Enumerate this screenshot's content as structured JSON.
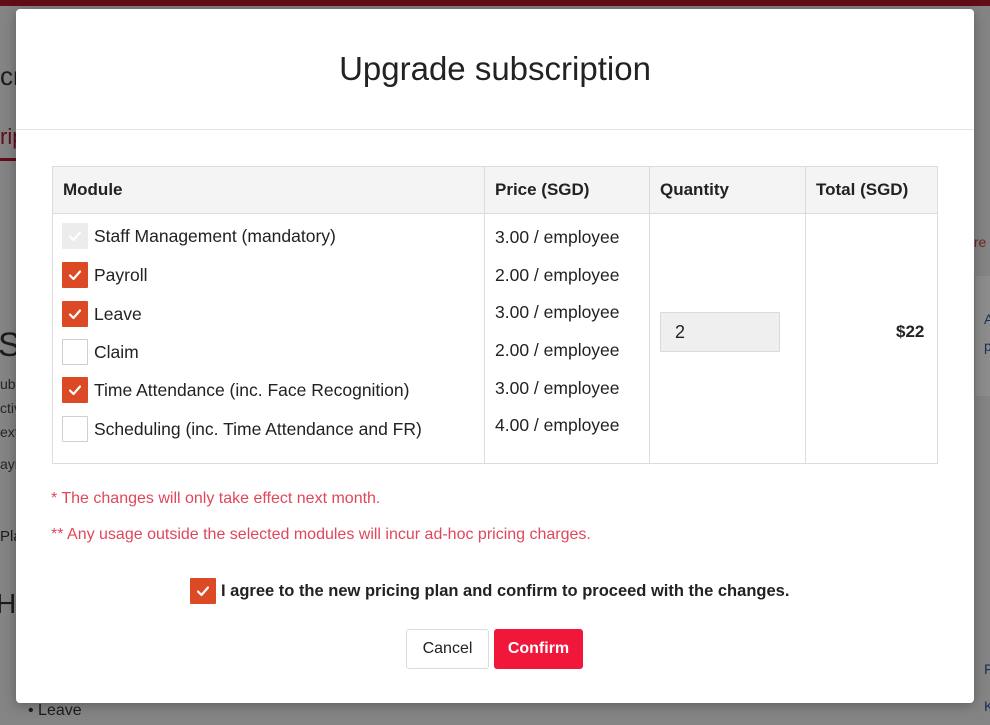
{
  "background": {
    "heading_fragment": "cr",
    "tab_fragment": "rip",
    "big_fragment": "Su",
    "lines": [
      "ubs",
      "ctiv",
      "ext",
      "ayr"
    ],
    "plan_fragment": "Pla",
    "H_fragment": "H",
    "leave_item": "• Leave",
    "right_link_fragment": "fre",
    "right_blue_1": "A",
    "right_blue_2": "p",
    "right_blue_3": "F",
    "right_blue_4": "K"
  },
  "modal": {
    "title": "Upgrade subscription",
    "table": {
      "headers": {
        "module": "Module",
        "price": "Price (SGD)",
        "quantity": "Quantity",
        "total": "Total (SGD)"
      },
      "rows": [
        {
          "label": "Staff Management (mandatory)",
          "price": "3.00 / employee",
          "checked": true,
          "disabled": true
        },
        {
          "label": "Payroll",
          "price": "2.00 / employee",
          "checked": true,
          "disabled": false
        },
        {
          "label": "Leave",
          "price": "3.00 / employee",
          "checked": true,
          "disabled": false
        },
        {
          "label": "Claim",
          "price": "2.00 / employee",
          "checked": false,
          "disabled": false
        },
        {
          "label": "Time Attendance (inc. Face Recognition)",
          "price": "3.00 / employee",
          "checked": true,
          "disabled": false
        },
        {
          "label": "Scheduling (inc. Time Attendance and FR)",
          "price": "4.00 / employee",
          "checked": false,
          "disabled": false
        }
      ],
      "quantity": "2",
      "total": "$22"
    },
    "notes": {
      "note1": "* The changes will only take effect next month.",
      "note2": "** Any usage outside the selected modules will incur ad-hoc pricing charges."
    },
    "agree": {
      "checked": true,
      "label": "I agree to the new pricing plan and confirm to proceed with the changes."
    },
    "buttons": {
      "cancel": "Cancel",
      "confirm": "Confirm"
    }
  },
  "colors": {
    "accent_checkbox": "#db4a24",
    "confirm_button": "#f0173b",
    "note_text": "#e0475a",
    "brand_bar": "#b3162e"
  }
}
